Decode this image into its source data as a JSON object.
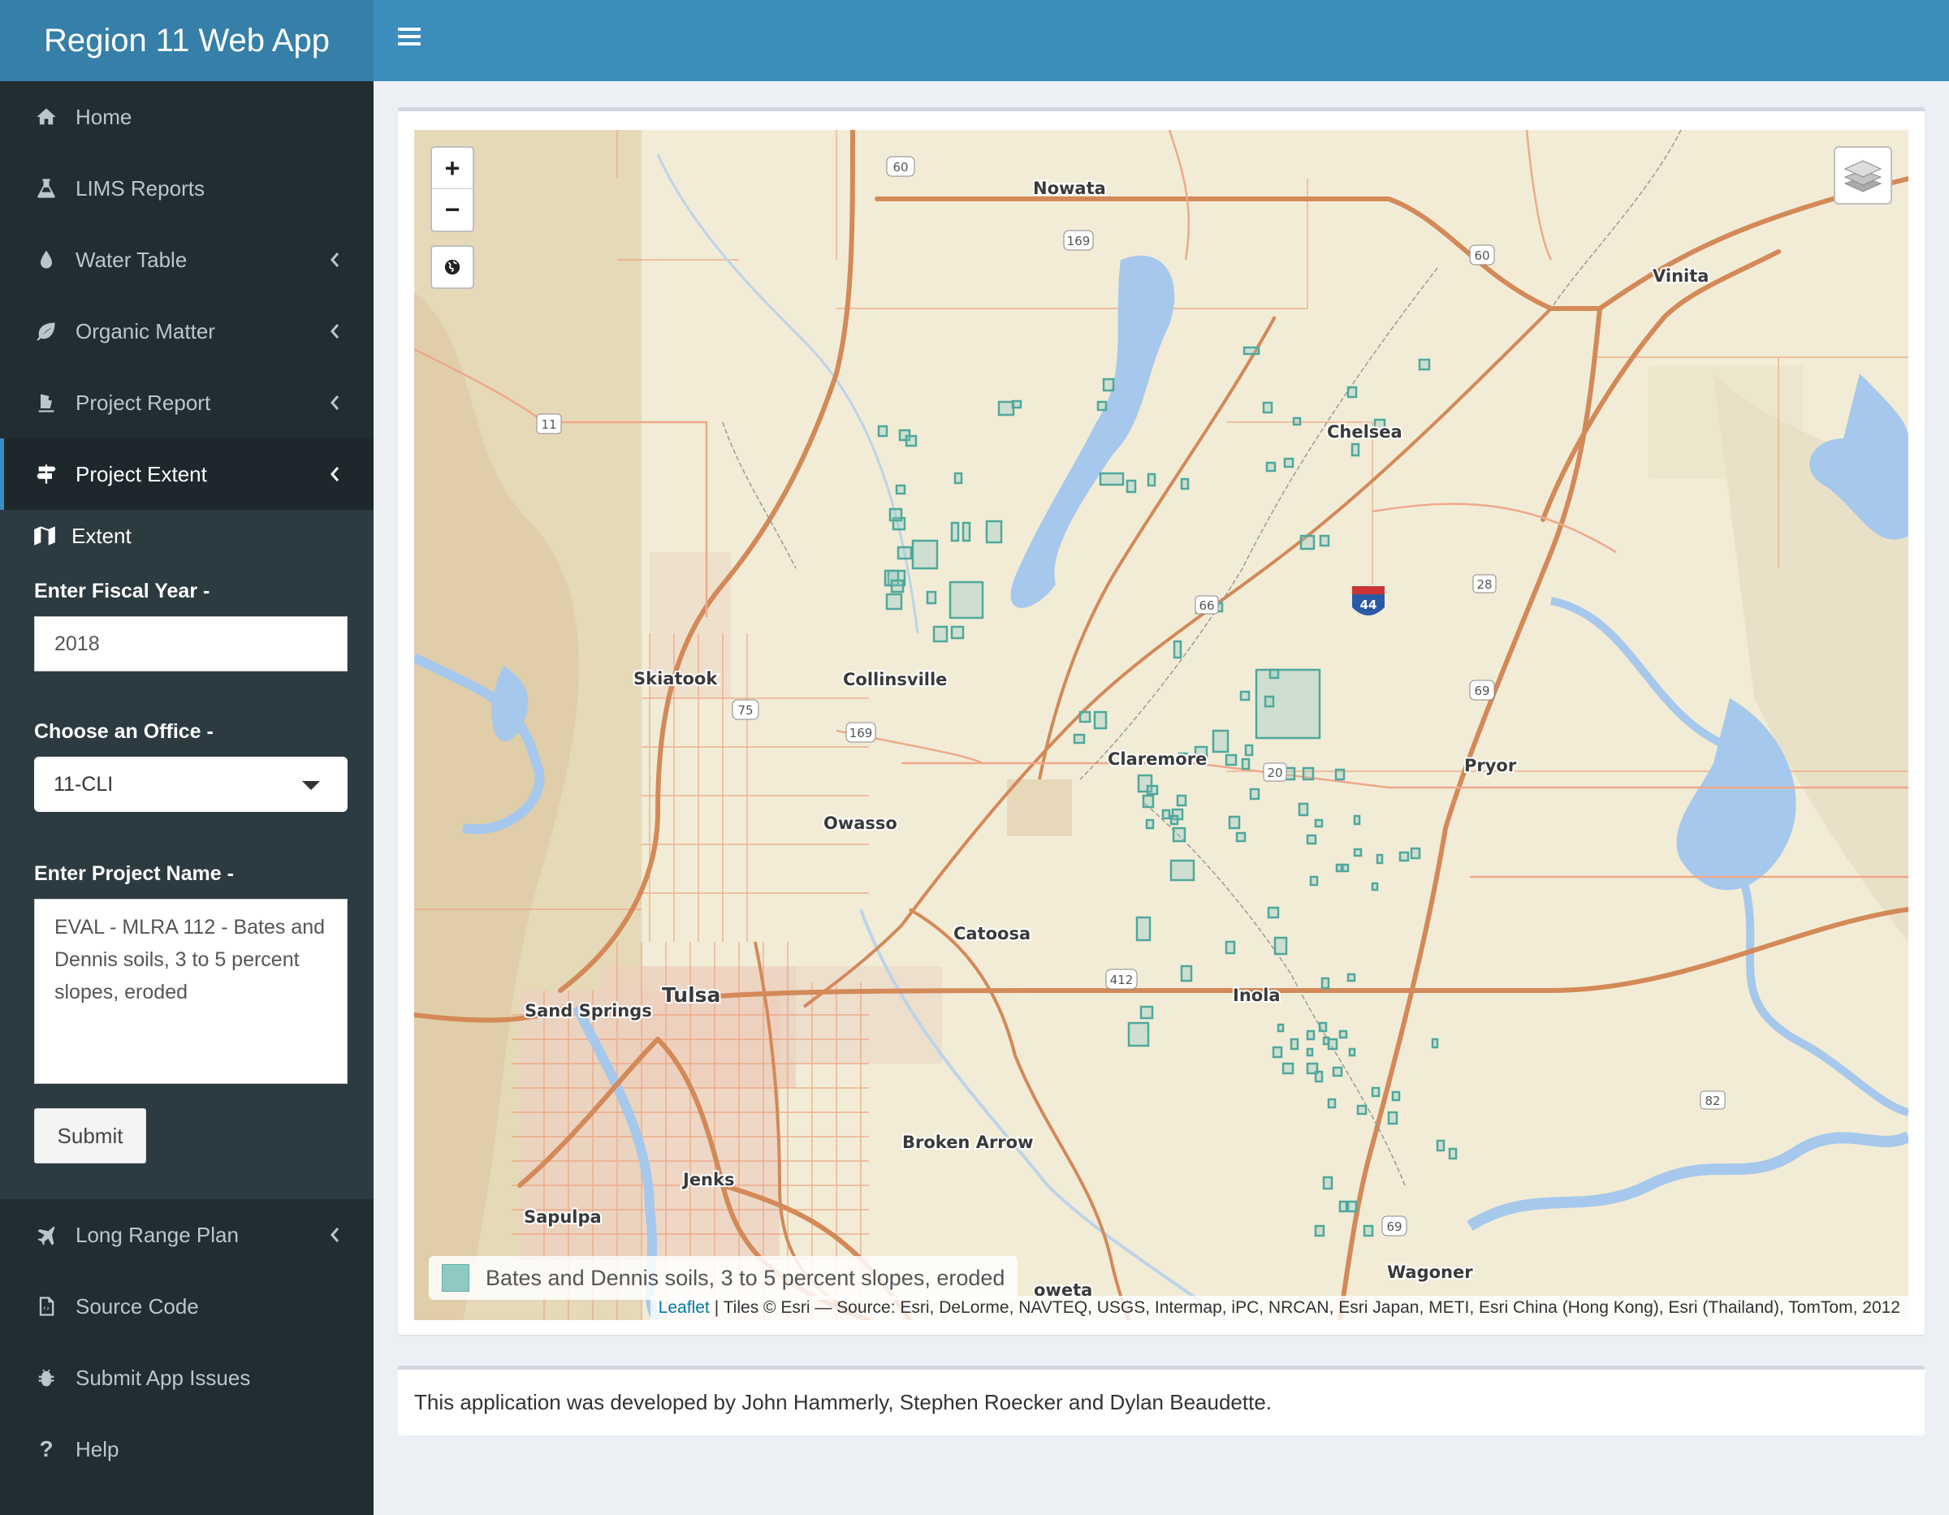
{
  "app": {
    "title": "Region 11 Web App"
  },
  "sidebar": {
    "items": [
      {
        "label": "Home",
        "icon": "home-icon"
      },
      {
        "label": "LIMS Reports",
        "icon": "flask-icon"
      },
      {
        "label": "Water Table",
        "icon": "tint-icon"
      },
      {
        "label": "Organic Matter",
        "icon": "leaf-icon"
      },
      {
        "label": "Project Report",
        "icon": "file-icon"
      },
      {
        "label": "Project Extent",
        "icon": "map-signs-icon"
      }
    ],
    "submenu": {
      "label": "Extent",
      "icon": "map-icon"
    },
    "lower_items": [
      {
        "label": "Long Range Plan",
        "icon": "plane-icon"
      },
      {
        "label": "Source Code",
        "icon": "code-file-icon"
      },
      {
        "label": "Submit App Issues",
        "icon": "bug-icon"
      },
      {
        "label": "Help",
        "icon": "question-icon"
      }
    ]
  },
  "form": {
    "fiscal_year_label": "Enter Fiscal Year -",
    "fiscal_year_value": "2018",
    "office_label": "Choose an Office -",
    "office_value": "11-CLI",
    "project_label": "Enter Project Name -",
    "project_value": "EVAL - MLRA 112 - Bates and Dennis soils, 3 to 5 percent slopes, eroded",
    "submit_label": "Submit"
  },
  "map": {
    "zoom_in": "+",
    "zoom_out": "−",
    "legend_label": "Bates and Dennis soils, 3 to 5 percent slopes, eroded",
    "legend_color": "#8fc9c2",
    "attribution_link": "Leaflet",
    "attribution_text": "| Tiles © Esri — Source: Esri, DeLorme, NAVTEQ, USGS, Intermap, iPC, NRCAN, Esri Japan, METI, Esri China (Hong Kong), Esri (Thailand), TomTom, 2012",
    "cities": [
      "Nowata",
      "Vinita",
      "Chelsea",
      "Skiatook",
      "Collinsville",
      "Claremore",
      "Pryor",
      "Owasso",
      "Catoosa",
      "Tulsa",
      "Sand Springs",
      "Inola",
      "Broken Arrow",
      "Jenks",
      "Sapulpa",
      "Wagoner",
      "oweta"
    ],
    "shields": [
      "60",
      "169",
      "60",
      "11",
      "66",
      "44",
      "28",
      "69",
      "75",
      "169",
      "20",
      "412",
      "82",
      "69"
    ]
  },
  "footer": {
    "text": "This application was developed by John Hammerly, Stephen Roecker and Dylan Beaudette."
  }
}
